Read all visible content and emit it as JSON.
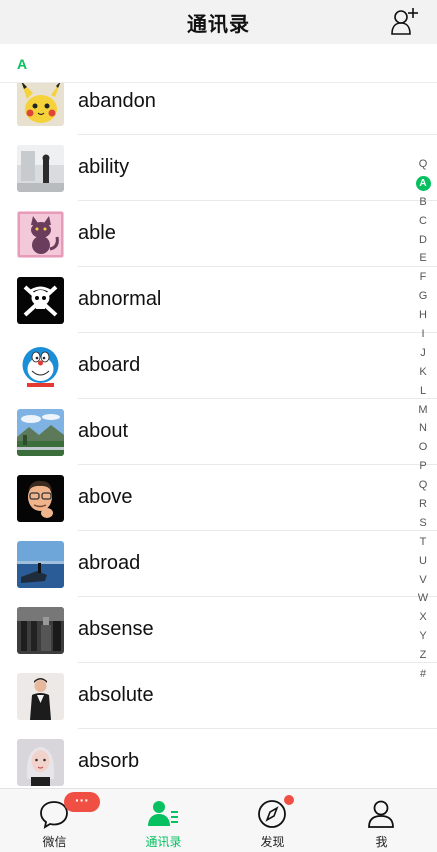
{
  "header": {
    "title": "通讯录"
  },
  "section": {
    "letter": "A"
  },
  "contacts": [
    {
      "name": "abandon",
      "avatar_icon": "pikachu-avatar"
    },
    {
      "name": "ability",
      "avatar_icon": "room-photo-avatar"
    },
    {
      "name": "able",
      "avatar_icon": "pink-cat-avatar"
    },
    {
      "name": "abnormal",
      "avatar_icon": "skull-flag-avatar"
    },
    {
      "name": "aboard",
      "avatar_icon": "doraemon-avatar"
    },
    {
      "name": "about",
      "avatar_icon": "landscape-avatar"
    },
    {
      "name": "above",
      "avatar_icon": "memoji-avatar"
    },
    {
      "name": "abroad",
      "avatar_icon": "sea-avatar"
    },
    {
      "name": "absense",
      "avatar_icon": "dark-room-avatar"
    },
    {
      "name": "absolute",
      "avatar_icon": "person-avatar"
    },
    {
      "name": "absorb",
      "avatar_icon": "girl-avatar"
    }
  ],
  "index": [
    "Q",
    "A",
    "B",
    "C",
    "D",
    "E",
    "F",
    "G",
    "H",
    "I",
    "J",
    "K",
    "L",
    "M",
    "N",
    "O",
    "P",
    "Q",
    "R",
    "S",
    "T",
    "U",
    "V",
    "W",
    "X",
    "Y",
    "Z",
    "#"
  ],
  "index_active": "A",
  "tabs": [
    {
      "label": "微信",
      "icon": "chat-icon"
    },
    {
      "label": "通讯录",
      "icon": "contacts-icon"
    },
    {
      "label": "发现",
      "icon": "compass-icon"
    },
    {
      "label": "我",
      "icon": "profile-icon"
    }
  ],
  "badges": {
    "chats": "···"
  },
  "colors": {
    "accent": "#07c160",
    "badge": "#f04f43"
  }
}
